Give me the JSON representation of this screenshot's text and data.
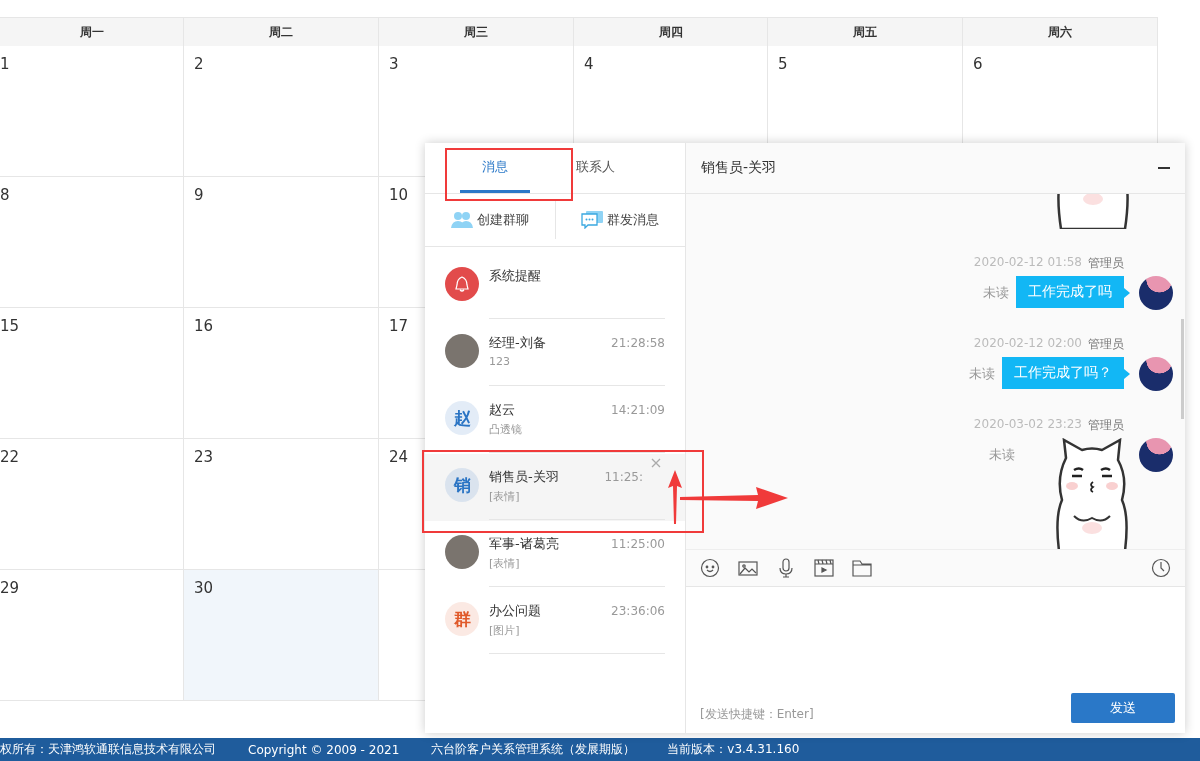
{
  "calendar": {
    "weekdays": [
      "周一",
      "周二",
      "周三",
      "周四",
      "周五",
      "周六"
    ],
    "weeks": [
      [
        {
          "day": "1",
          "highlighted": false
        },
        {
          "day": "2",
          "highlighted": false
        },
        {
          "day": "3",
          "highlighted": false
        },
        {
          "day": "4",
          "highlighted": false
        },
        {
          "day": "5",
          "highlighted": false
        },
        {
          "day": "6",
          "highlighted": false
        }
      ],
      [
        {
          "day": "8",
          "highlighted": false
        },
        {
          "day": "9",
          "highlighted": false
        },
        {
          "day": "10",
          "highlighted": false
        }
      ],
      [
        {
          "day": "15",
          "highlighted": false
        },
        {
          "day": "16",
          "highlighted": false
        },
        {
          "day": "17",
          "highlighted": false
        }
      ],
      [
        {
          "day": "22",
          "highlighted": false
        },
        {
          "day": "23",
          "highlighted": false
        },
        {
          "day": "24",
          "highlighted": false
        }
      ],
      [
        {
          "day": "29",
          "highlighted": false
        },
        {
          "day": "30",
          "highlighted": true
        }
      ]
    ]
  },
  "chat": {
    "tabs": [
      {
        "label": "消息",
        "selected": true
      },
      {
        "label": "联系人",
        "selected": false
      }
    ],
    "actions": [
      {
        "kind": "group",
        "label": "创建群聊"
      },
      {
        "kind": "broadcast",
        "label": "群发消息"
      }
    ],
    "conversations": [
      {
        "name": "系统提醒",
        "kind": "bell",
        "hovered": false
      },
      {
        "name": "经理-刘备",
        "time": "21:28:58",
        "preview": "123",
        "kind": "photo",
        "hovered": false
      },
      {
        "name": "赵云",
        "time": "14:21:09",
        "preview": "凸透镜",
        "kind": "letter",
        "avatar_text": "赵",
        "color": "#2a74c4",
        "hovered": false
      },
      {
        "name": "销售员-关羽",
        "time": "11:25:",
        "preview": "[表情]",
        "kind": "letter",
        "avatar_text": "销",
        "color": "#2a74c4",
        "hovered": true
      },
      {
        "name": "军事-诸葛亮",
        "time": "11:25:00",
        "preview": "[表情]",
        "kind": "photo",
        "hovered": false
      },
      {
        "name": "办公问题",
        "time": "23:36:06",
        "preview": "[图片]",
        "kind": "letter",
        "avatar_text": "群",
        "color": "#e05a2b",
        "hovered": false
      }
    ]
  },
  "conversation": {
    "title": "销售员-关羽",
    "messages": [
      {
        "kind": "sticker"
      },
      {
        "kind": "text",
        "time": "2020-02-12 01:58",
        "sender": "管理员",
        "status": "未读",
        "text": "工作完成了吗"
      },
      {
        "kind": "text",
        "time": "2020-02-12 02:00",
        "sender": "管理员",
        "status": "未读",
        "text": "工作完成了吗？"
      },
      {
        "kind": "sticker",
        "time": "2020-03-02 23:23",
        "sender": "管理员",
        "status": "未读"
      }
    ],
    "shortcut_hint": "[发送快捷键：Enter]",
    "send_label": "发送"
  },
  "footer": [
    "权所有：天津鸿软通联信息技术有限公司",
    "Copyright © 2009 - 2021",
    "六台阶客户关系管理系统（发展期版）",
    "当前版本：v3.4.31.160"
  ]
}
